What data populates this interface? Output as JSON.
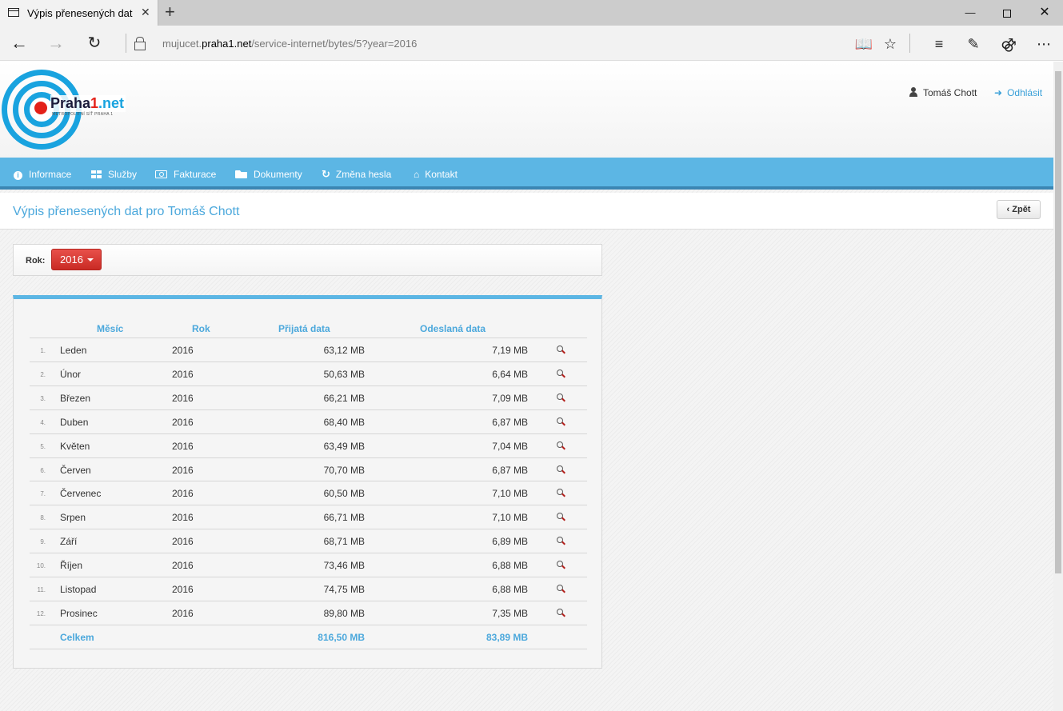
{
  "browser": {
    "tab_title": "Výpis přenesených dat p",
    "tab_close": "✕",
    "new_tab": "+",
    "url_prefix": "mujucet.",
    "url_domain": "praha1.net",
    "url_path": "/service-internet/bytes/5?year=2016",
    "icons": [
      "back-icon",
      "forward-icon",
      "refresh-icon",
      "lock-icon",
      "reading-view-icon",
      "favorite-star-icon",
      "hub-icon",
      "web-note-icon",
      "share-icon",
      "more-icon"
    ]
  },
  "header": {
    "logo_main": "Praha",
    "logo_num": "1",
    "logo_tld": ".net",
    "logo_sub": "METROPOLITNÍ SÍŤ PRAHA 1",
    "user_name": "Tomáš Chott",
    "logout_label": "Odhlásit"
  },
  "nav": {
    "items": [
      {
        "label": "Informace",
        "icon": "info-icon"
      },
      {
        "label": "Služby",
        "icon": "grid-icon"
      },
      {
        "label": "Fakturace",
        "icon": "money-icon"
      },
      {
        "label": "Dokumenty",
        "icon": "folder-icon"
      },
      {
        "label": "Změna hesla",
        "icon": "refresh-icon"
      },
      {
        "label": "Kontakt",
        "icon": "home-icon"
      }
    ]
  },
  "page": {
    "title": "Výpis přenesených dat pro Tomáš Chott",
    "back_label": "Zpět"
  },
  "filter": {
    "label": "Rok:",
    "year": "2016"
  },
  "table": {
    "headers": {
      "month": "Měsíc",
      "year": "Rok",
      "received": "Přijatá data",
      "sent": "Odeslaná data"
    },
    "rows": [
      {
        "num": "1.",
        "month": "Leden",
        "year": "2016",
        "received": "63,12 MB",
        "sent": "7,19 MB"
      },
      {
        "num": "2.",
        "month": "Únor",
        "year": "2016",
        "received": "50,63 MB",
        "sent": "6,64 MB"
      },
      {
        "num": "3.",
        "month": "Březen",
        "year": "2016",
        "received": "66,21 MB",
        "sent": "7,09 MB"
      },
      {
        "num": "4.",
        "month": "Duben",
        "year": "2016",
        "received": "68,40 MB",
        "sent": "6,87 MB"
      },
      {
        "num": "5.",
        "month": "Květen",
        "year": "2016",
        "received": "63,49 MB",
        "sent": "7,04 MB"
      },
      {
        "num": "6.",
        "month": "Červen",
        "year": "2016",
        "received": "70,70 MB",
        "sent": "6,87 MB"
      },
      {
        "num": "7.",
        "month": "Červenec",
        "year": "2016",
        "received": "60,50 MB",
        "sent": "7,10 MB"
      },
      {
        "num": "8.",
        "month": "Srpen",
        "year": "2016",
        "received": "66,71 MB",
        "sent": "7,10 MB"
      },
      {
        "num": "9.",
        "month": "Září",
        "year": "2016",
        "received": "68,71 MB",
        "sent": "6,89 MB"
      },
      {
        "num": "10.",
        "month": "Říjen",
        "year": "2016",
        "received": "73,46 MB",
        "sent": "6,88 MB"
      },
      {
        "num": "11.",
        "month": "Listopad",
        "year": "2016",
        "received": "74,75 MB",
        "sent": "6,88 MB"
      },
      {
        "num": "12.",
        "month": "Prosinec",
        "year": "2016",
        "received": "89,80 MB",
        "sent": "7,35 MB"
      }
    ],
    "total": {
      "label": "Celkem",
      "received": "816,50 MB",
      "sent": "83,89 MB"
    }
  },
  "colors": {
    "accent": "#5cb6e4",
    "title_blue": "#4ba8dc",
    "year_button": "#d9362f",
    "logo_red": "#e32119"
  }
}
